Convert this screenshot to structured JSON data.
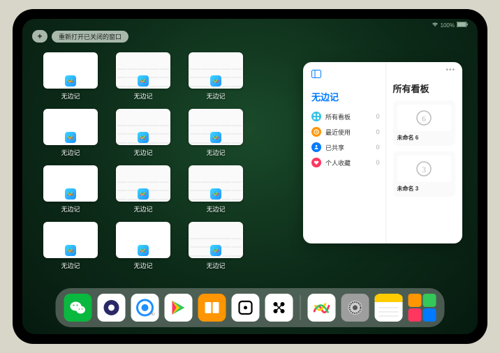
{
  "status": {
    "battery": "100%"
  },
  "topbar": {
    "plus": "+",
    "reopen": "重新打开已关闭的窗口"
  },
  "apps": [
    {
      "label": "无边记",
      "style": "blank"
    },
    {
      "label": "无边记",
      "style": "calendar"
    },
    {
      "label": "无边记",
      "style": "calendar"
    },
    {
      "label": "无边记",
      "style": "blank"
    },
    {
      "label": "无边记",
      "style": "calendar"
    },
    {
      "label": "无边记",
      "style": "calendar"
    },
    {
      "label": "无边记",
      "style": "blank"
    },
    {
      "label": "无边记",
      "style": "calendar"
    },
    {
      "label": "无边记",
      "style": "calendar"
    },
    {
      "label": "无边记",
      "style": "blank"
    },
    {
      "label": "无边记",
      "style": "blank"
    },
    {
      "label": "无边记",
      "style": "calendar"
    }
  ],
  "panel": {
    "left_title": "无边记",
    "right_title": "所有看板",
    "categories": [
      {
        "icon": "grid",
        "color": "#34c2e6",
        "label": "所有看板",
        "count": "0"
      },
      {
        "icon": "clock",
        "color": "#ff9500",
        "label": "最近使用",
        "count": "0"
      },
      {
        "icon": "share",
        "color": "#007aff",
        "label": "已共享",
        "count": "0"
      },
      {
        "icon": "heart",
        "color": "#ff375f",
        "label": "个人收藏",
        "count": "0"
      }
    ],
    "boards": [
      {
        "name": "未命名 6",
        "glyph": "6"
      },
      {
        "name": "未命名 3",
        "glyph": "3"
      }
    ]
  },
  "dock": {
    "items": [
      {
        "name": "wechat",
        "bg": "#09b83e",
        "glyph": "wechat"
      },
      {
        "name": "quark",
        "bg": "#ffffff",
        "glyph": "quark"
      },
      {
        "name": "qqbrowser",
        "bg": "#ffffff",
        "glyph": "qqb"
      },
      {
        "name": "play",
        "bg": "#ffffff",
        "glyph": "play"
      },
      {
        "name": "books",
        "bg": "#ff9500",
        "glyph": "books"
      },
      {
        "name": "dice",
        "bg": "#ffffff",
        "glyph": "dice"
      },
      {
        "name": "dots",
        "bg": "#ffffff",
        "glyph": "dots"
      }
    ],
    "recents": [
      {
        "name": "freeform",
        "bg": "#ffffff",
        "glyph": "freeform"
      },
      {
        "name": "settings",
        "bg": "#9e9e9e",
        "glyph": "gear"
      },
      {
        "name": "notes",
        "bg": "#ffffff",
        "glyph": "notes"
      }
    ]
  }
}
